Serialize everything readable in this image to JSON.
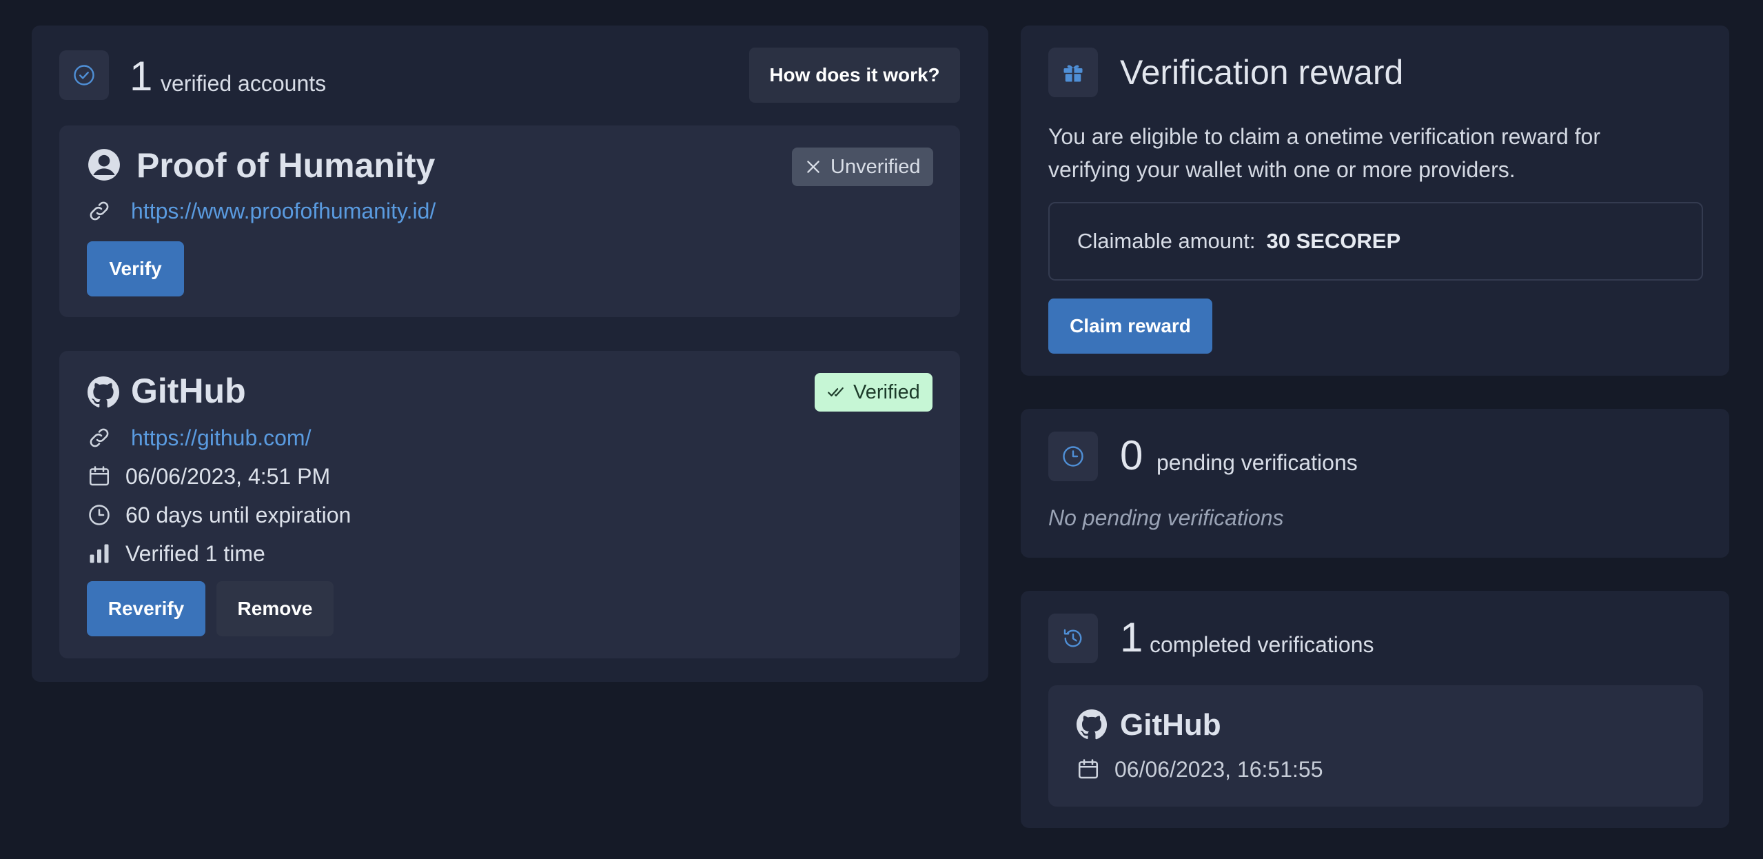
{
  "accounts": {
    "count": "1",
    "count_label": "verified accounts",
    "how_button": "How does it work?",
    "providers": [
      {
        "name": "Proof of Humanity",
        "url": "https://www.proofofhumanity.id/",
        "status": "Unverified",
        "action": "Verify"
      },
      {
        "name": "GitHub",
        "url": "https://github.com/",
        "status": "Verified",
        "date": "06/06/2023, 4:51 PM",
        "expiration": "60 days until expiration",
        "times": "Verified 1 time",
        "action": "Reverify",
        "secondary_action": "Remove"
      }
    ]
  },
  "reward": {
    "title": "Verification reward",
    "description": "You are eligible to claim a onetime verification reward for verifying your wallet with one or more providers.",
    "amount_label": "Claimable amount:",
    "amount_value": "30 SECOREP",
    "claim_button": "Claim reward"
  },
  "pending": {
    "count": "0",
    "count_label": "pending verifications",
    "empty_text": "No pending verifications"
  },
  "completed": {
    "count": "1",
    "count_label": "completed verifications",
    "items": [
      {
        "name": "GitHub",
        "date": "06/06/2023, 16:51:55"
      }
    ]
  },
  "colors": {
    "background": "#151a27",
    "panel": "#1e2436",
    "card": "#272d41",
    "accent": "#3a73ba",
    "link": "#5a9be0",
    "verified_badge": "#c6f6d5",
    "unverified_badge": "#4a5264"
  }
}
